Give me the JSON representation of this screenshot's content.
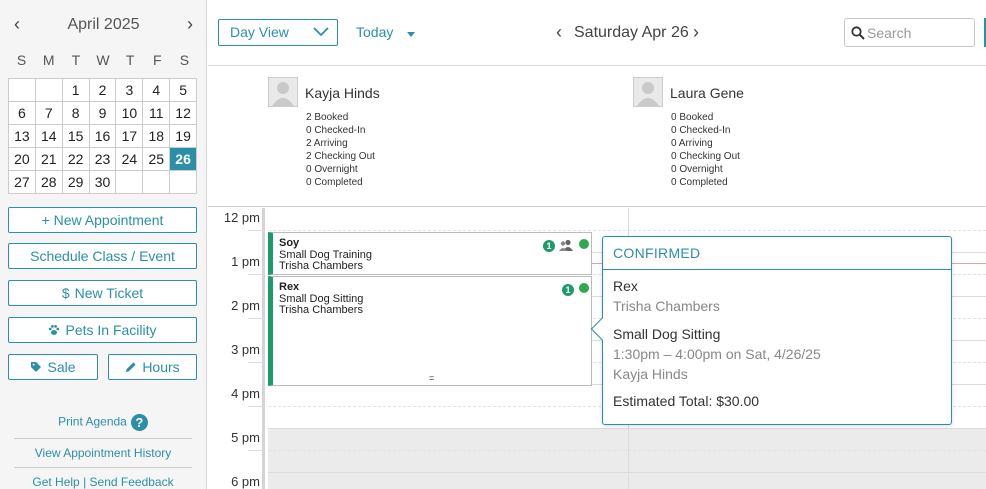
{
  "calendar": {
    "month_title": "April 2025",
    "prev_icon": "chevron-left-icon",
    "next_icon": "chevron-right-icon",
    "weekdays": [
      "S",
      "M",
      "T",
      "W",
      "T",
      "F",
      "S"
    ],
    "weeks": [
      [
        "",
        "",
        "1",
        "2",
        "3",
        "4",
        "5"
      ],
      [
        "6",
        "7",
        "8",
        "9",
        "10",
        "11",
        "12"
      ],
      [
        "13",
        "14",
        "15",
        "16",
        "17",
        "18",
        "19"
      ],
      [
        "20",
        "21",
        "22",
        "23",
        "24",
        "25",
        "26"
      ],
      [
        "27",
        "28",
        "29",
        "30",
        "",
        "",
        ""
      ]
    ],
    "selected_day": "26"
  },
  "sidebar": {
    "new_appointment": "+ New Appointment",
    "schedule_class": "Schedule Class / Event",
    "new_ticket": "New Ticket",
    "pets_in_facility": "Pets In Facility",
    "sale": "Sale",
    "hours": "Hours",
    "print_agenda": "Print Agenda",
    "view_history": "View Appointment History",
    "get_help": "Get Help",
    "link_separator": "|",
    "send_feedback": "Send Feedback"
  },
  "toolbar": {
    "view_select": "Day View",
    "today": "Today",
    "date_title": "Saturday Apr 26",
    "search_placeholder": "Search"
  },
  "staff": [
    {
      "name": "Kayja Hinds",
      "stats": [
        "2 Booked",
        "0 Checked-In",
        "2 Arriving",
        "2 Checking Out",
        "0 Overnight",
        "0 Completed"
      ]
    },
    {
      "name": "Laura Gene",
      "stats": [
        "0 Booked",
        "0 Checked-In",
        "0 Arriving",
        "0 Checking Out",
        "0 Overnight",
        "0 Completed"
      ]
    }
  ],
  "hours": [
    "12 pm",
    "1 pm",
    "2 pm",
    "3 pm",
    "4 pm",
    "5 pm",
    "6 pm"
  ],
  "appointments": [
    {
      "pet": "Soy",
      "service": "Small Dog Training",
      "owner": "Trisha Chambers",
      "badge": "1",
      "group_icon": "group-icon",
      "status_color": "#2fa84f"
    },
    {
      "pet": "Rex",
      "service": "Small Dog Sitting",
      "owner": "Trisha Chambers",
      "badge": "1",
      "status_color": "#2fa84f",
      "grip": "="
    }
  ],
  "popover": {
    "status": "CONFIRMED",
    "pet": "Rex",
    "owner": "Trisha Chambers",
    "service": "Small Dog Sitting",
    "time": "1:30pm – 4:00pm on Sat, 4/26/25",
    "staff": "Kayja Hinds",
    "total": "Estimated Total: $30.00"
  },
  "colors": {
    "accent": "#2b8fa8",
    "appt_bar": "#1e9b6b",
    "status_dot": "#2fa84f",
    "now_line": "#e3a1a8"
  }
}
